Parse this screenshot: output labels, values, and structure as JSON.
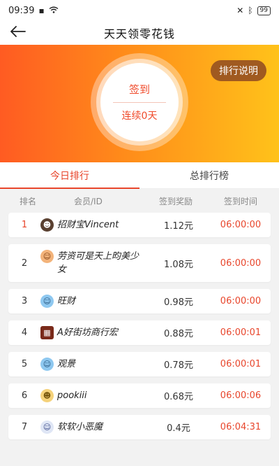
{
  "status_bar": {
    "time": "09:39",
    "battery": "99"
  },
  "nav": {
    "title": "天天领零花钱"
  },
  "banner": {
    "sign_label": "签到",
    "streak": "连续0天",
    "rule_button": "排行说明"
  },
  "tabs": [
    {
      "label": "今日排行",
      "active": true
    },
    {
      "label": "总排行榜",
      "active": false
    }
  ],
  "columns": {
    "rank": "排名",
    "member": "会员/ID",
    "reward": "签到奖励",
    "time": "签到时间"
  },
  "rows": [
    {
      "rank": "1",
      "name": "招财宝Vincent",
      "reward": "1.12元",
      "time": "06:00:00"
    },
    {
      "rank": "2",
      "name": "劳资可是天上昀美少女",
      "reward": "1.08元",
      "time": "06:00:00"
    },
    {
      "rank": "3",
      "name": "旺财",
      "reward": "0.98元",
      "time": "06:00:00"
    },
    {
      "rank": "4",
      "name": "A好街坊商行宏",
      "reward": "0.88元",
      "time": "06:00:01"
    },
    {
      "rank": "5",
      "name": "观景",
      "reward": "0.78元",
      "time": "06:00:01"
    },
    {
      "rank": "6",
      "name": "pookiii",
      "reward": "0.68元",
      "time": "06:00:06"
    },
    {
      "rank": "7",
      "name": "软软小恶魔",
      "reward": "0.4元",
      "time": "06:04:31"
    }
  ],
  "icons": {
    "back": "arrow-left-icon",
    "wifi": "wifi-icon",
    "signal": "signal-icon",
    "bluetooth": "bluetooth-icon",
    "avatar": "avatar"
  }
}
